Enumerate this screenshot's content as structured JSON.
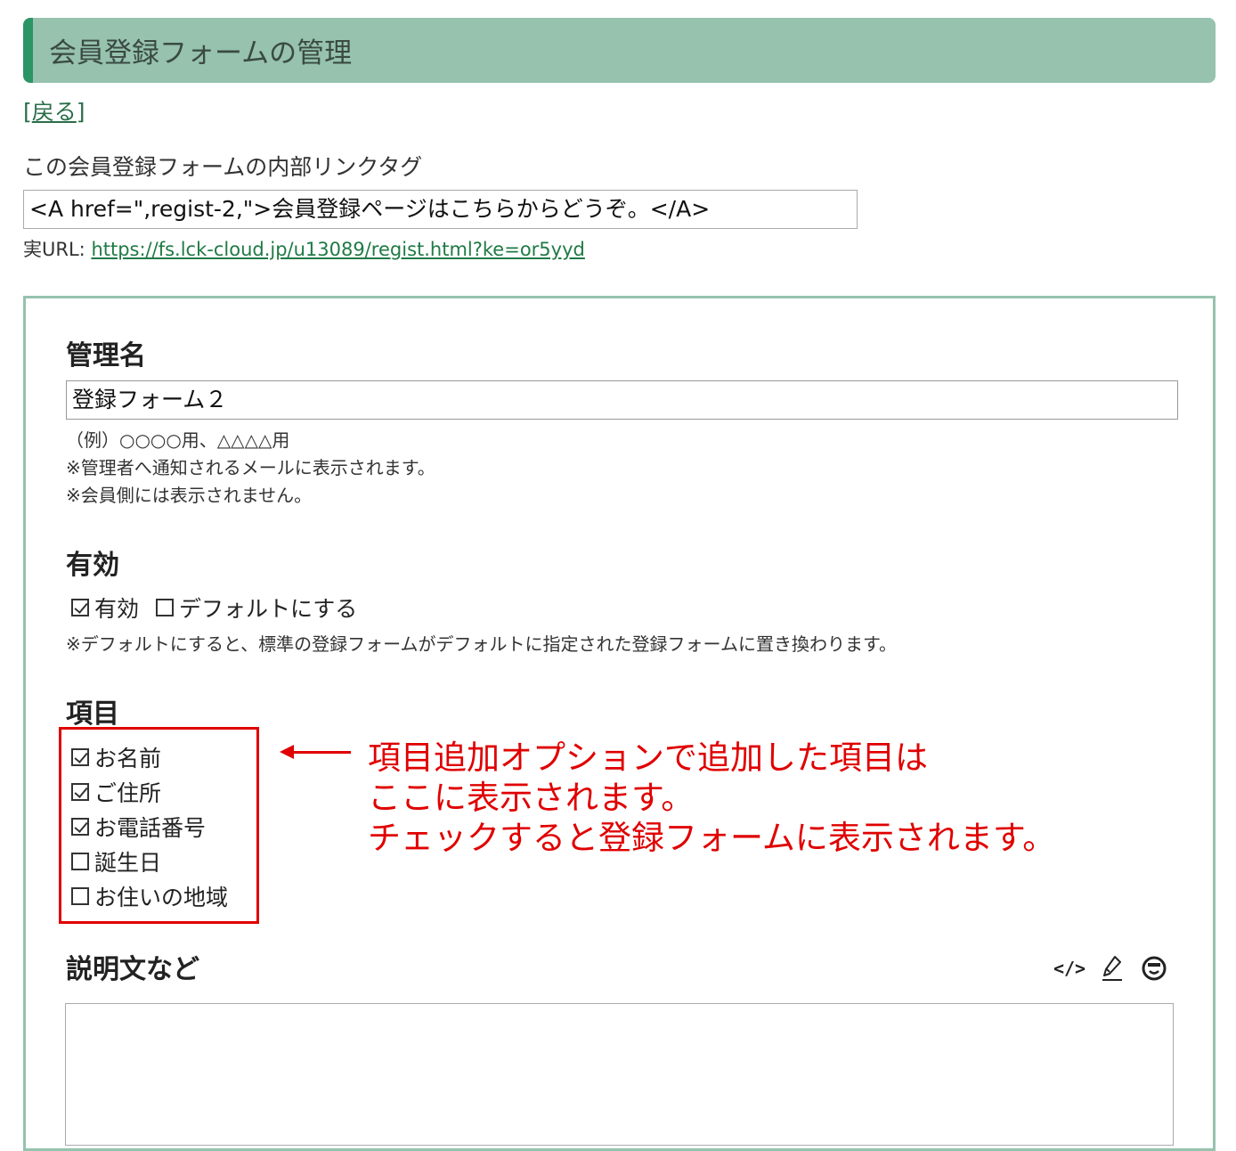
{
  "header": {
    "title": "会員登録フォームの管理"
  },
  "back": {
    "bracket_open": "[",
    "label": "戻る",
    "bracket_close": "]"
  },
  "link_tag": {
    "label": "この会員登録フォームの内部リンクタグ",
    "value": "<A href=\",regist-2,\">会員登録ページはこちらからどうぞ。</A>",
    "url_label": "実URL:",
    "url": "https://fs.lck-cloud.jp/u13089/regist.html?ke=or5yyd"
  },
  "name_section": {
    "title": "管理名",
    "value": "登録フォーム２",
    "notes": [
      "（例）○○○○用、△△△△用",
      "※管理者へ通知されるメールに表示されます。",
      "※会員側には表示されません。"
    ]
  },
  "enabled_section": {
    "title": "有効",
    "options": [
      {
        "label": "有効",
        "checked": true
      },
      {
        "label": "デフォルトにする",
        "checked": false
      }
    ],
    "note": "※デフォルトにすると、標準の登録フォームがデフォルトに指定された登録フォームに置き換わります。"
  },
  "items_section": {
    "title": "項目",
    "items": [
      {
        "label": "お名前",
        "checked": true
      },
      {
        "label": "ご住所",
        "checked": true
      },
      {
        "label": "お電話番号",
        "checked": true
      },
      {
        "label": "誕生日",
        "checked": false
      },
      {
        "label": "お住いの地域",
        "checked": false
      }
    ]
  },
  "annotation": {
    "lines": [
      "項目追加オプションで追加した項目は",
      "ここに表示されます。",
      "チェックすると登録フォームに表示されます。"
    ],
    "color": "#e00000"
  },
  "description_section": {
    "title": "説明文など",
    "tools": [
      {
        "icon": "code-icon",
        "label": "</>"
      },
      {
        "icon": "pen-icon"
      },
      {
        "icon": "emoji-icon"
      }
    ]
  },
  "colors": {
    "header_bg": "#96c2ae",
    "header_accent": "#2b9566",
    "link": "#1f7a45"
  }
}
